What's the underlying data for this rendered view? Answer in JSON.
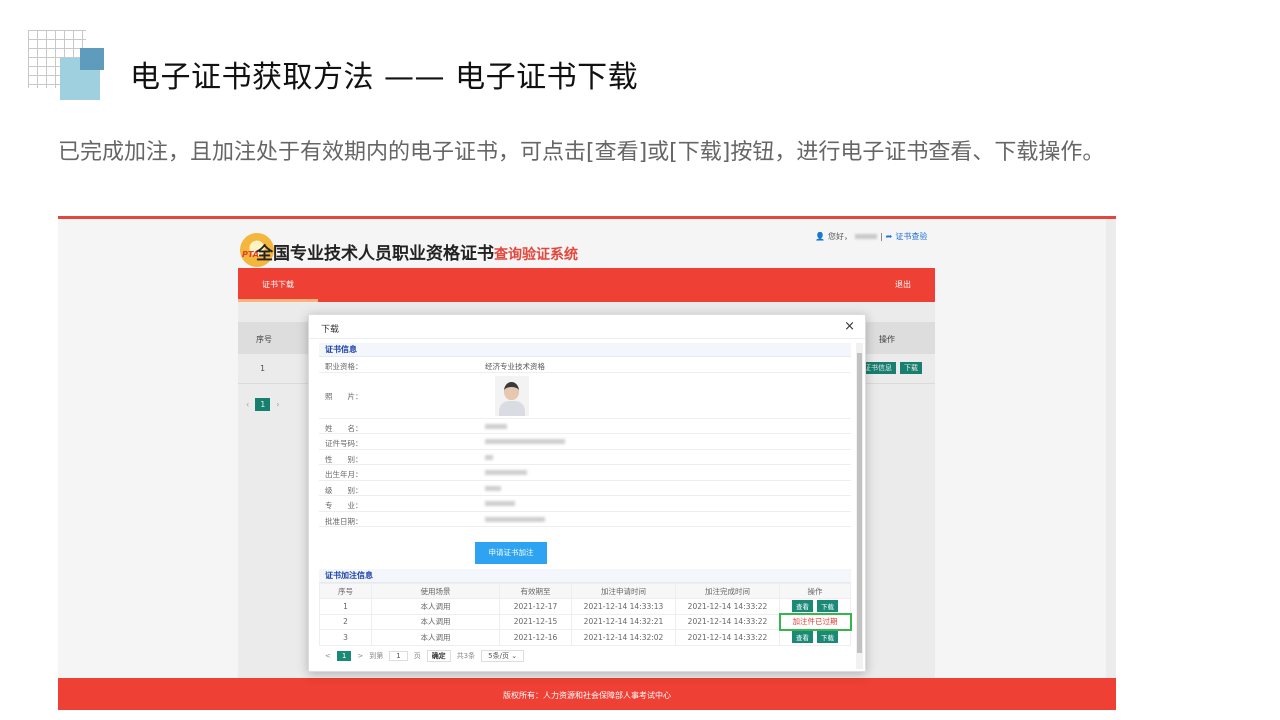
{
  "slide": {
    "title": "电子证书获取方法 —— 电子证书下载",
    "description": "已完成加注，且加注处于有效期内的电子证书，可点击[查看]或[下载]按钮，进行电子证书查看、下载操作。"
  },
  "site": {
    "logo_text": "PTA",
    "title_main": "全国专业技术人员职业资格证书",
    "title_red": "查询验证系统",
    "greeting": "您好，",
    "verify_link": "证书查验",
    "nav_tab": "证书下载",
    "logout": "退出",
    "footer": "版权所有：人力资源和社会保障部人事考试中心",
    "colors": {
      "brand_red": "#ee4034",
      "accent_green": "#1a8a77",
      "button_blue": "#2ea3f2"
    }
  },
  "background_table": {
    "col_index": "序号",
    "col_action": "操作",
    "row_index": "1",
    "btn_info": "证书信息",
    "btn_download": "下载",
    "page": "1"
  },
  "modal": {
    "title": "下载",
    "close": "×",
    "cert_section": "证书信息",
    "fields": {
      "qualification_label": "职业资格：",
      "qualification_value": "经济专业技术资格",
      "photo_label": "照　　片：",
      "name_label": "姓　　名：",
      "id_label": "证件号码：",
      "gender_label": "性　　别：",
      "birth_label": "出生年月：",
      "level_label": "级　　别：",
      "major_label": "专　　业：",
      "approve_label": "批准日期："
    },
    "apply_button": "申请证书加注",
    "ext_section": "证书加注信息",
    "ext_headers": [
      "序号",
      "使用场景",
      "有效期至",
      "加注申请时间",
      "加注完成时间",
      "操作"
    ],
    "ext_rows": [
      {
        "index": "1",
        "scene": "本人调用",
        "valid": "2021-12-17",
        "apply": "2021-12-14 14:33:13",
        "done": "2021-12-14 14:33:22"
      },
      {
        "index": "2",
        "scene": "本人调用",
        "valid": "2021-12-15",
        "apply": "2021-12-14 14:32:21",
        "done": "2021-12-14 14:33:22"
      },
      {
        "index": "3",
        "scene": "本人调用",
        "valid": "2021-12-16",
        "apply": "2021-12-14 14:32:02",
        "done": "2021-12-14 14:33:22"
      }
    ],
    "btn_view": "查看",
    "btn_download": "下载",
    "expired_text": "加注件已过期",
    "pager": {
      "prev": "<",
      "page": "1",
      "next": ">",
      "goto": "到第",
      "input": "1",
      "unit": "页",
      "confirm": "确定",
      "total": "共3条",
      "size": "5条/页"
    }
  }
}
